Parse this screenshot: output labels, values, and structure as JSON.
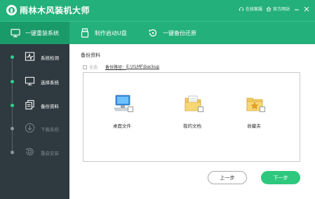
{
  "app": {
    "title": "雨林木风装机大师",
    "online_service": "在线客服",
    "official_site": "官方网站"
  },
  "nav": {
    "tabs": [
      {
        "label": "一键重装系统",
        "icon": "monitor-icon",
        "active": true
      },
      {
        "label": "制作启动U盘",
        "icon": "usb-icon",
        "active": false
      },
      {
        "label": "一键备份还原",
        "icon": "restore-icon",
        "active": false
      }
    ]
  },
  "sidebar": {
    "steps": [
      {
        "label": "系统检测",
        "icon": "pulse-icon",
        "state": "done"
      },
      {
        "label": "选择系统",
        "icon": "display-icon",
        "state": "done"
      },
      {
        "label": "备份资料",
        "icon": "copy-icon",
        "state": "current"
      },
      {
        "label": "下载系统",
        "icon": "download-icon",
        "state": "pending"
      },
      {
        "label": "重启安装",
        "icon": "reboot-icon",
        "state": "pending"
      }
    ]
  },
  "main": {
    "section_title": "备份资料",
    "select_all_label": "全选",
    "path_label": "备份路径：",
    "path_value": "E:\\YLMF\\backup",
    "files": [
      {
        "label": "桌面文件",
        "icon": "desktop-computer-icon",
        "checked": false
      },
      {
        "label": "我的文档",
        "icon": "documents-folder-icon",
        "checked": false
      },
      {
        "label": "收藏夹",
        "icon": "favorites-folder-icon",
        "checked": false
      }
    ],
    "prev_button": "上一步",
    "next_button": "下一步"
  },
  "colors": {
    "accent": "#23b07a",
    "sidebar_bg": "#2f3a40",
    "next_button": "#2dc87d"
  }
}
